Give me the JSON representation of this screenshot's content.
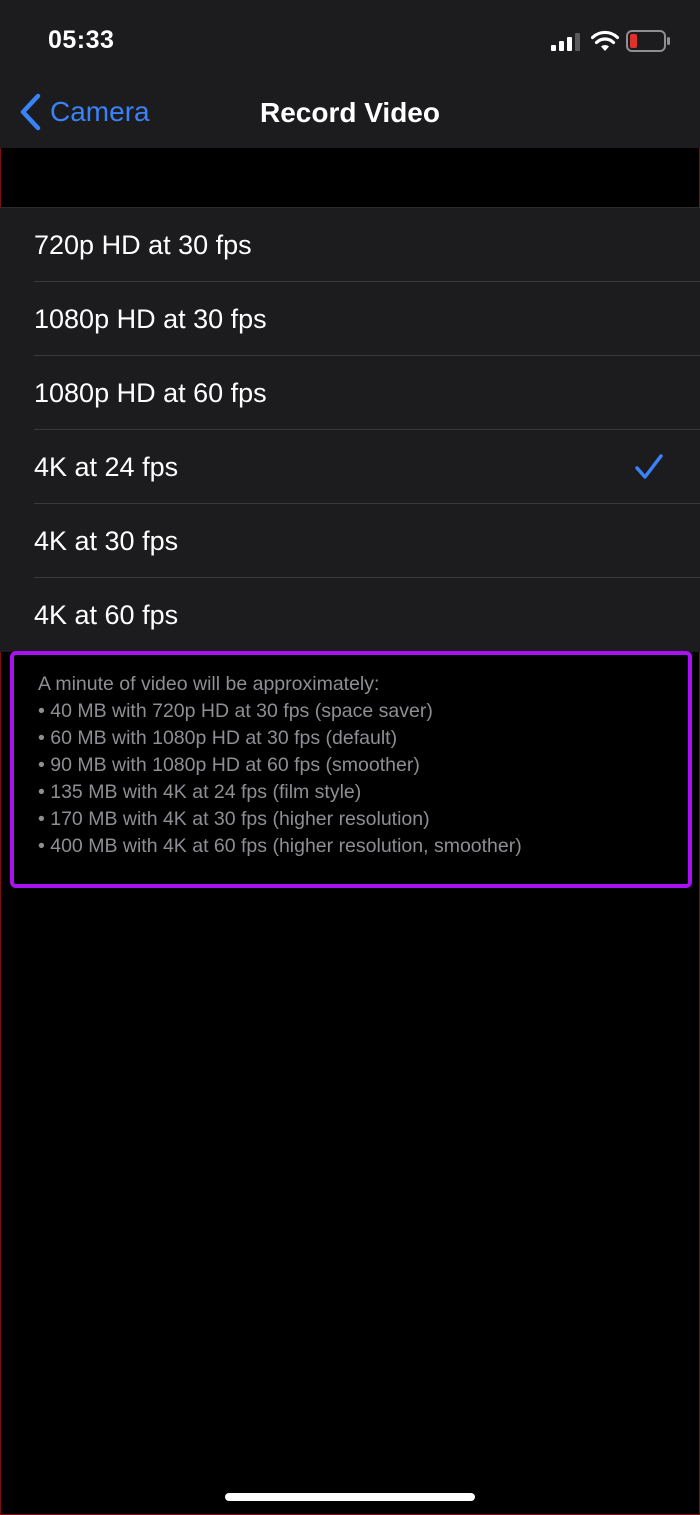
{
  "status_bar": {
    "time": "05:33",
    "icons": [
      "cellular-signal-icon",
      "wifi-icon",
      "battery-low-icon"
    ]
  },
  "nav": {
    "back_label": "Camera",
    "title": "Record Video"
  },
  "options": [
    {
      "label": "720p HD at 30 fps",
      "selected": false
    },
    {
      "label": "1080p HD at 30 fps",
      "selected": false
    },
    {
      "label": "1080p HD at 60 fps",
      "selected": false
    },
    {
      "label": "4K at 24 fps",
      "selected": true
    },
    {
      "label": "4K at 30 fps",
      "selected": false
    },
    {
      "label": "4K at 60 fps",
      "selected": false
    }
  ],
  "note": {
    "heading": "A minute of video will be approximately:",
    "lines": [
      "• 40 MB with 720p HD at 30 fps (space saver)",
      "• 60 MB with 1080p HD at 30 fps (default)",
      "• 90 MB with 1080p HD at 60 fps (smoother)",
      "• 135 MB with 4K at 24 fps (film style)",
      "• 170 MB with 4K at 30 fps (higher resolution)",
      "• 400 MB with 4K at 60 fps (higher resolution, smoother)"
    ]
  },
  "colors": {
    "accent": "#3a82f7",
    "highlight": "#a911f2",
    "battery_low": "#e0312a",
    "background": "#000000",
    "cell": "#1c1c1e"
  }
}
